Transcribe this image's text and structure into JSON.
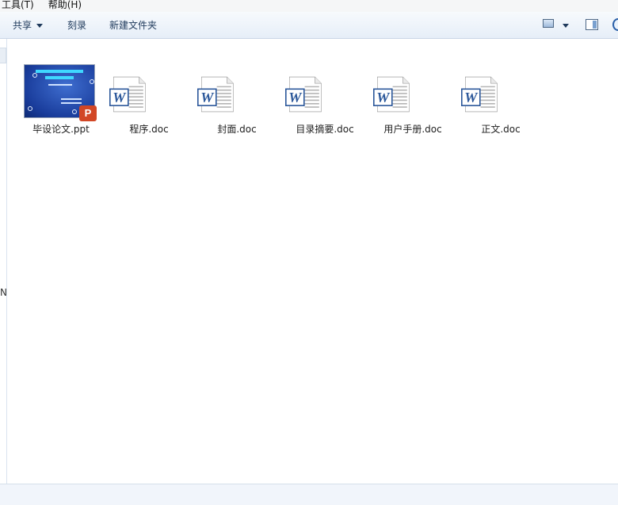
{
  "menu": {
    "tools": "工具(T)",
    "help": "帮助(H)"
  },
  "toolbar": {
    "share": "共享",
    "burn": "刻录",
    "new_folder": "新建文件夹"
  },
  "nav": {
    "letter": "N"
  },
  "files": [
    {
      "name": "毕设论文.ppt",
      "type": "ppt"
    },
    {
      "name": "程序.doc",
      "type": "doc"
    },
    {
      "name": "封面.doc",
      "type": "doc"
    },
    {
      "name": "目录摘要.doc",
      "type": "doc"
    },
    {
      "name": "用户手册.doc",
      "type": "doc"
    },
    {
      "name": "正文.doc",
      "type": "doc"
    }
  ],
  "colors": {
    "word_blue": "#2b579a",
    "ppt_orange": "#d24726",
    "toolbar_text": "#1e395b"
  }
}
